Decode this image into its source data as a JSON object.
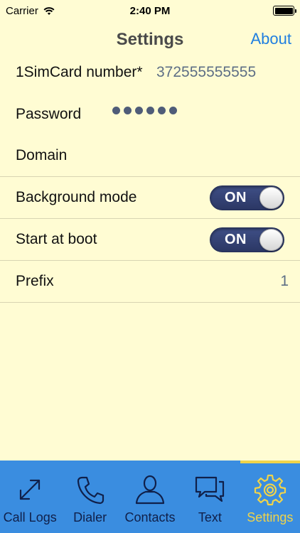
{
  "status_bar": {
    "carrier": "Carrier",
    "time": "2:40 PM"
  },
  "nav": {
    "title": "Settings",
    "about_label": "About"
  },
  "settings": {
    "sim_label": "1SimCard number*",
    "sim_value": "372555555555",
    "password_label": "Password",
    "domain_label": "Domain",
    "background_label": "Background mode",
    "background_toggle": "ON",
    "boot_label": "Start at boot",
    "boot_toggle": "ON",
    "prefix_label": "Prefix",
    "prefix_value": "1"
  },
  "tabs": [
    {
      "label": "Call Logs",
      "icon": "call-logs-icon"
    },
    {
      "label": "Dialer",
      "icon": "phone-icon"
    },
    {
      "label": "Contacts",
      "icon": "contacts-icon"
    },
    {
      "label": "Text",
      "icon": "chat-icon"
    },
    {
      "label": "Settings",
      "icon": "gear-icon"
    }
  ],
  "colors": {
    "background": "#fffcd3",
    "accent": "#1f7ee0",
    "tab_bar": "#3a8de0",
    "tab_active": "#f0d44a",
    "toggle": "#334077"
  }
}
